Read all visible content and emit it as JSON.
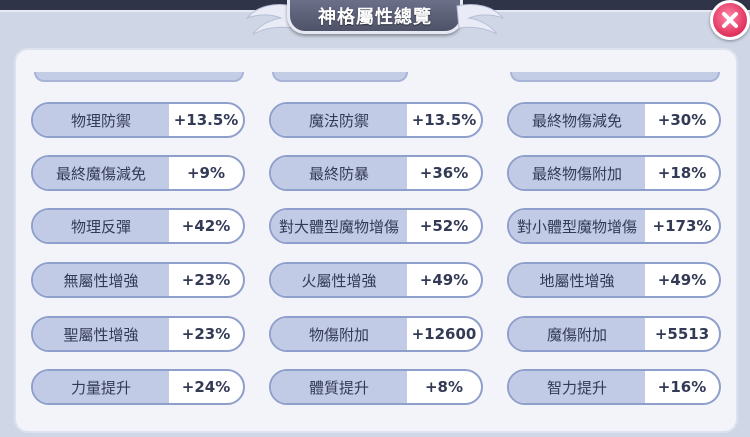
{
  "header": {
    "title": "神格屬性總覽",
    "close_icon": "close-icon"
  },
  "stats": [
    [
      {
        "label": "物理防禦",
        "value": "+13.5%"
      },
      {
        "label": "魔法防禦",
        "value": "+13.5%"
      },
      {
        "label": "最終物傷減免",
        "value": "+30%"
      }
    ],
    [
      {
        "label": "最終魔傷減免",
        "value": "+9%"
      },
      {
        "label": "最終防暴",
        "value": "+36%"
      },
      {
        "label": "最終物傷附加",
        "value": "+18%"
      }
    ],
    [
      {
        "label": "物理反彈",
        "value": "+42%"
      },
      {
        "label": "對大體型魔物增傷",
        "value": "+52%"
      },
      {
        "label": "對小體型魔物增傷",
        "value": "+173%"
      }
    ],
    [
      {
        "label": "無屬性增強",
        "value": "+23%"
      },
      {
        "label": "火屬性增強",
        "value": "+49%"
      },
      {
        "label": "地屬性增強",
        "value": "+49%"
      }
    ],
    [
      {
        "label": "聖屬性增強",
        "value": "+23%"
      },
      {
        "label": "物傷附加",
        "value": "+12600"
      },
      {
        "label": "魔傷附加",
        "value": "+5513"
      }
    ],
    [
      {
        "label": "力量提升",
        "value": "+24%"
      },
      {
        "label": "體質提升",
        "value": "+8%"
      },
      {
        "label": "智力提升",
        "value": "+16%"
      }
    ]
  ]
}
